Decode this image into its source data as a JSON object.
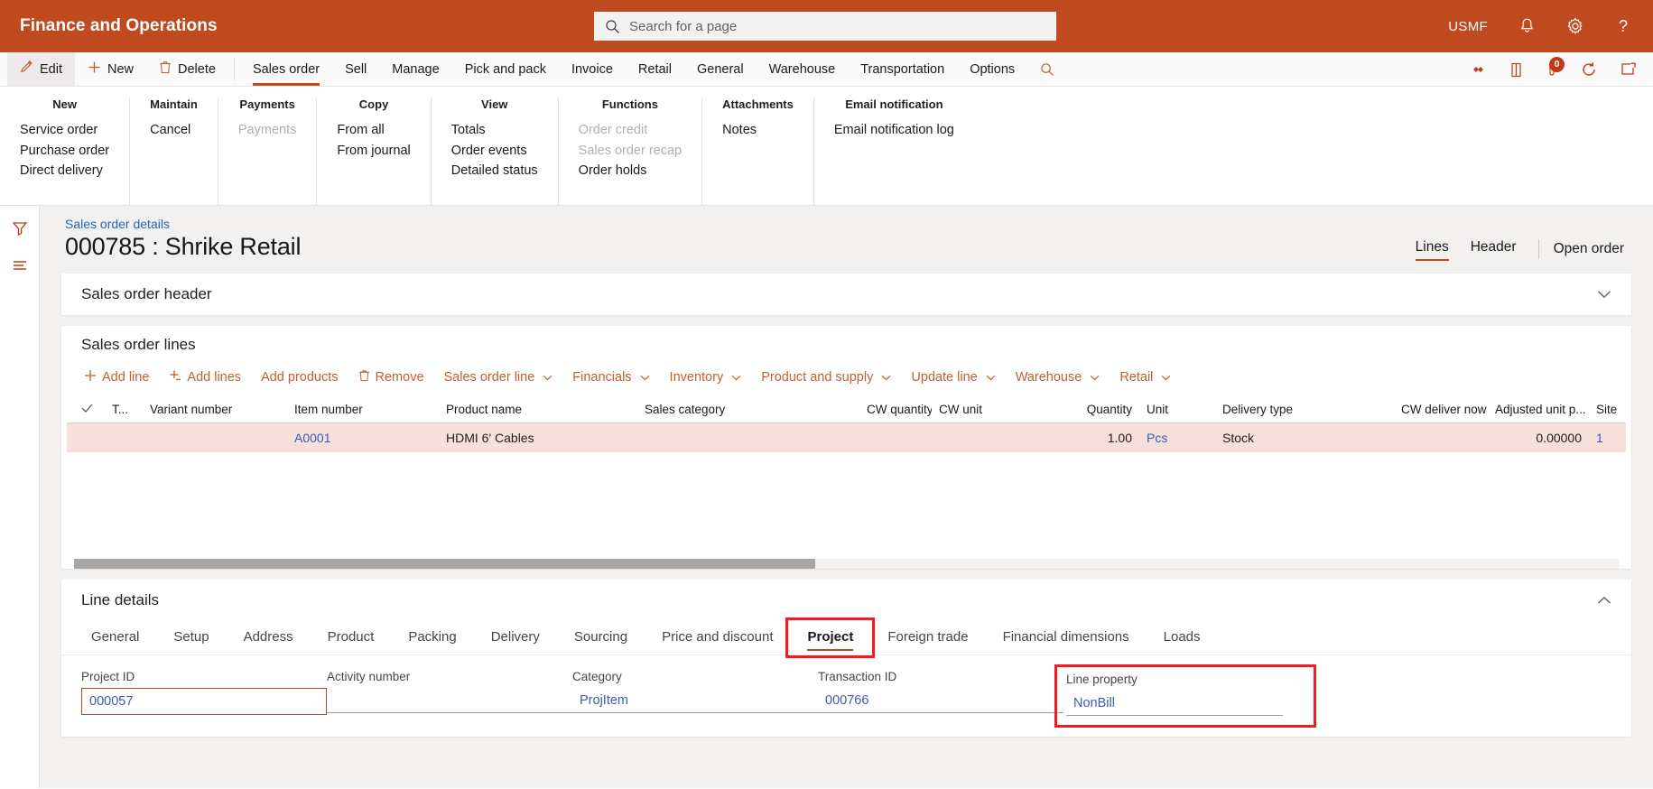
{
  "topbar": {
    "app_title": "Finance and Operations",
    "search_placeholder": "Search for a page",
    "search_value": "",
    "company": "USMF",
    "icons": [
      "search-icon",
      "notification-bell-icon",
      "settings-gear-icon",
      "help-question-icon"
    ]
  },
  "menubar": {
    "edit": "Edit",
    "new": "New",
    "delete": "Delete",
    "tabs": [
      {
        "label": "Sales order",
        "active": true
      },
      {
        "label": "Sell",
        "active": false
      },
      {
        "label": "Manage",
        "active": false
      },
      {
        "label": "Pick and pack",
        "active": false
      },
      {
        "label": "Invoice",
        "active": false
      },
      {
        "label": "Retail",
        "active": false
      },
      {
        "label": "General",
        "active": false
      },
      {
        "label": "Warehouse",
        "active": false
      },
      {
        "label": "Transportation",
        "active": false
      },
      {
        "label": "Options",
        "active": false
      }
    ],
    "notification_count": "0"
  },
  "ribbon": {
    "groups": [
      {
        "title": "New",
        "items": [
          {
            "label": "Service order",
            "disabled": false
          },
          {
            "label": "Purchase order",
            "disabled": false
          },
          {
            "label": "Direct delivery",
            "disabled": false
          }
        ]
      },
      {
        "title": "Maintain",
        "items": [
          {
            "label": "Cancel",
            "disabled": false
          }
        ]
      },
      {
        "title": "Payments",
        "items": [
          {
            "label": "Payments",
            "disabled": true
          }
        ]
      },
      {
        "title": "Copy",
        "items": [
          {
            "label": "From all",
            "disabled": false
          },
          {
            "label": "From journal",
            "disabled": false
          }
        ]
      },
      {
        "title": "View",
        "items": [
          {
            "label": "Totals",
            "disabled": false
          },
          {
            "label": "Order events",
            "disabled": false
          },
          {
            "label": "Detailed status",
            "disabled": false
          }
        ]
      },
      {
        "title": "Functions",
        "items": [
          {
            "label": "Order credit",
            "disabled": true
          },
          {
            "label": "Sales order recap",
            "disabled": true
          },
          {
            "label": "Order holds",
            "disabled": false
          }
        ]
      },
      {
        "title": "Attachments",
        "items": [
          {
            "label": "Notes",
            "disabled": false
          }
        ]
      },
      {
        "title": "Email notification",
        "items": [
          {
            "label": "Email notification log",
            "disabled": false
          }
        ]
      }
    ]
  },
  "page": {
    "breadcrumb": "Sales order details",
    "title": "000785 : Shrike Retail",
    "view_tabs": [
      {
        "label": "Lines",
        "active": true
      },
      {
        "label": "Header",
        "active": false
      }
    ],
    "open_order_link": "Open order"
  },
  "header_card": {
    "title": "Sales order header"
  },
  "lines_card": {
    "title": "Sales order lines",
    "toolbar": [
      {
        "label": "Add line",
        "icon": "plus-icon",
        "caret": false
      },
      {
        "label": "Add lines",
        "icon": "plus-lines-icon",
        "caret": false
      },
      {
        "label": "Add products",
        "icon": "",
        "caret": false
      },
      {
        "label": "Remove",
        "icon": "trash-icon",
        "caret": false
      },
      {
        "label": "Sales order line",
        "icon": "",
        "caret": true
      },
      {
        "label": "Financials",
        "icon": "",
        "caret": true
      },
      {
        "label": "Inventory",
        "icon": "",
        "caret": true
      },
      {
        "label": "Product and supply",
        "icon": "",
        "caret": true
      },
      {
        "label": "Update line",
        "icon": "",
        "caret": true
      },
      {
        "label": "Warehouse",
        "icon": "",
        "caret": true
      },
      {
        "label": "Retail",
        "icon": "",
        "caret": true
      }
    ],
    "columns": [
      "T...",
      "Variant number",
      "Item number",
      "Product name",
      "Sales category",
      "CW quantity",
      "CW unit",
      "Quantity",
      "Unit",
      "Delivery type",
      "CW deliver now",
      "Adjusted unit p...",
      "Site"
    ],
    "rows": [
      {
        "t": "",
        "variant_number": "",
        "item_number": "A0001",
        "product_name": "HDMI 6' Cables",
        "sales_category": "",
        "cw_quantity": "",
        "cw_unit": "",
        "quantity": "1.00",
        "unit": "Pcs",
        "delivery_type": "Stock",
        "cw_deliver_now": "",
        "adjusted_unit_price": "0.00000",
        "site": "1",
        "selected": true
      }
    ]
  },
  "line_details": {
    "title": "Line details",
    "tabs": [
      {
        "label": "General",
        "active": false
      },
      {
        "label": "Setup",
        "active": false
      },
      {
        "label": "Address",
        "active": false
      },
      {
        "label": "Product",
        "active": false
      },
      {
        "label": "Packing",
        "active": false
      },
      {
        "label": "Delivery",
        "active": false
      },
      {
        "label": "Sourcing",
        "active": false
      },
      {
        "label": "Price and discount",
        "active": false
      },
      {
        "label": "Project",
        "active": true
      },
      {
        "label": "Foreign trade",
        "active": false
      },
      {
        "label": "Financial dimensions",
        "active": false
      },
      {
        "label": "Loads",
        "active": false
      }
    ],
    "fields": [
      {
        "label": "Project ID",
        "value": "000057",
        "focused": true
      },
      {
        "label": "Activity number",
        "value": "",
        "focused": false
      },
      {
        "label": "Category",
        "value": "ProjItem",
        "focused": false
      },
      {
        "label": "Transaction ID",
        "value": "000766",
        "focused": false
      },
      {
        "label": "Line property",
        "value": "NonBill",
        "focused": false
      }
    ]
  },
  "annotations": {
    "highlight_color": "#ee1c25",
    "targets": [
      "project-tab",
      "line-property-field"
    ]
  },
  "colors": {
    "brand": "#bf4a20",
    "accent_link": "#3b5bb5",
    "row_selected": "#f7dfdb",
    "toolbar_link": "#c4602f"
  }
}
